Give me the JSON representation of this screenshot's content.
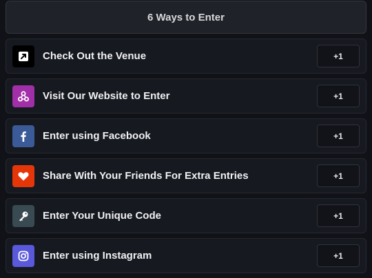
{
  "header": {
    "title": "6 Ways to Enter"
  },
  "entries": [
    {
      "label": "Check Out the Venue",
      "points": "+1",
      "icon": "external-link-icon",
      "color": "#000000"
    },
    {
      "label": "Visit Our Website to Enter",
      "points": "+1",
      "icon": "webhook-icon",
      "color": "#a02fa8"
    },
    {
      "label": "Enter using Facebook",
      "points": "+1",
      "icon": "facebook-icon",
      "color": "#3b5b98"
    },
    {
      "label": "Share With Your Friends For Extra Entries",
      "points": "+1",
      "icon": "heart-icon",
      "color": "#e5360a"
    },
    {
      "label": "Enter Your Unique Code",
      "points": "+1",
      "icon": "key-icon",
      "color": "#3a4a52"
    },
    {
      "label": "Enter using Instagram",
      "points": "+1",
      "icon": "instagram-icon",
      "color": "#5a58db"
    }
  ]
}
